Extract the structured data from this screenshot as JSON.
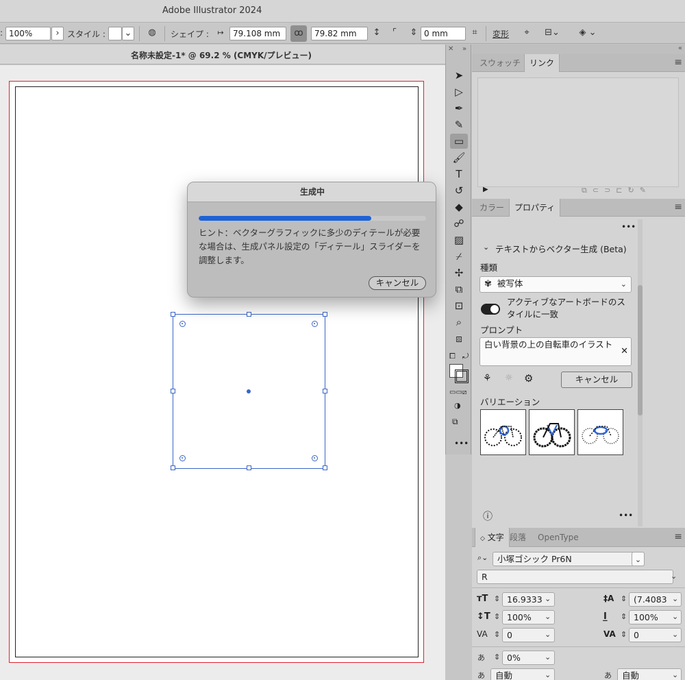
{
  "app": {
    "title": "Adobe Illustrator 2024"
  },
  "control_bar": {
    "zoom": "100%",
    "style_label": "スタイル :",
    "shape_label": "シェイプ :",
    "width": "79.108 mm",
    "height": "79.82 mm",
    "corner": "0 mm",
    "transform_label": "変形"
  },
  "document": {
    "tab_title": "名称未設定-1* @ 69.2 % (CMYK/プレビュー)"
  },
  "dialog": {
    "title": "生成中",
    "progress": 0.76,
    "hint": "ヒント：ベクターグラフィックに多少のディテールが必要な場合は、生成パネル設定の「ディテール」スライダーを調整します。",
    "cancel": "キャンセル"
  },
  "swatch_panel": {
    "tabs": [
      "スウォッチ",
      "リンク"
    ],
    "active": 1
  },
  "properties_panel": {
    "tabs": [
      "カラー",
      "プロパティ"
    ],
    "section_title": "テキストからベクター生成 (Beta)",
    "type_label": "種類",
    "type_value": "被写体",
    "match_style_label": "アクティブなアートボードのスタイルに一致",
    "prompt_label": "プロンプト",
    "prompt_value": "白い背景の上の自転車のイラスト",
    "cancel": "キャンセル",
    "variations_label": "バリエーション"
  },
  "type_panel": {
    "tabs": [
      "文字",
      "段落",
      "OpenType"
    ],
    "font_family": "小塚ゴシック Pr6N",
    "font_style": "R",
    "font_size": "16.9333",
    "leading": "(7.4083",
    "vertical_scale": "100%",
    "horizontal_scale": "100%",
    "kerning": "0",
    "tracking": "0",
    "tsume": "0%",
    "aki_left": "自動",
    "aki_right": "自動"
  },
  "colors": {
    "accent": "#1e63d6",
    "selection": "#3a65c7",
    "artboard_border": "#e0202f"
  }
}
